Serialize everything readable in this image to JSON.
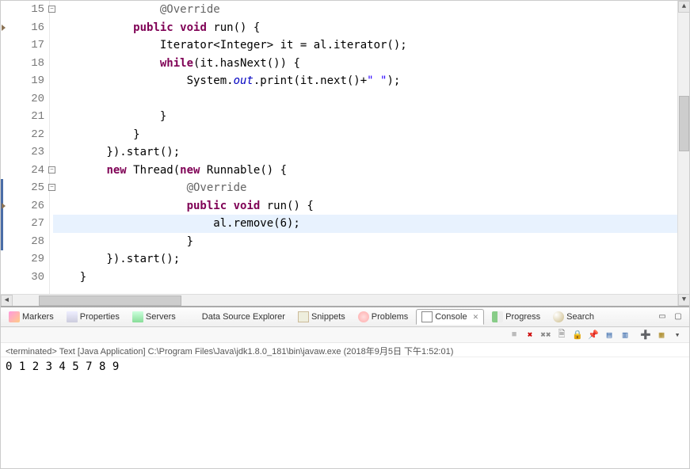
{
  "editor": {
    "highlighted_line_number": 27,
    "lines": [
      {
        "n": 15,
        "fold": true,
        "marker": "",
        "bp": false,
        "tokens": [
          {
            "t": "                ",
            "c": ""
          },
          {
            "t": "@Override",
            "c": "ann"
          }
        ]
      },
      {
        "n": 16,
        "fold": false,
        "marker": "triangle",
        "bp": false,
        "tokens": [
          {
            "t": "            ",
            "c": ""
          },
          {
            "t": "public",
            "c": "kw"
          },
          {
            "t": " ",
            "c": ""
          },
          {
            "t": "void",
            "c": "kw"
          },
          {
            "t": " run() {",
            "c": ""
          }
        ]
      },
      {
        "n": 17,
        "fold": false,
        "marker": "",
        "bp": false,
        "tokens": [
          {
            "t": "                Iterator<Integer> it = al.iterator();",
            "c": ""
          }
        ]
      },
      {
        "n": 18,
        "fold": false,
        "marker": "",
        "bp": false,
        "tokens": [
          {
            "t": "                ",
            "c": ""
          },
          {
            "t": "while",
            "c": "kw"
          },
          {
            "t": "(it.hasNext()) {",
            "c": ""
          }
        ]
      },
      {
        "n": 19,
        "fold": false,
        "marker": "",
        "bp": false,
        "tokens": [
          {
            "t": "                    System.",
            "c": ""
          },
          {
            "t": "out",
            "c": "static-field"
          },
          {
            "t": ".print(it.next()+",
            "c": ""
          },
          {
            "t": "\" \"",
            "c": "str"
          },
          {
            "t": ");",
            "c": ""
          }
        ]
      },
      {
        "n": 20,
        "fold": false,
        "marker": "",
        "bp": false,
        "tokens": [
          {
            "t": "                    ",
            "c": ""
          }
        ]
      },
      {
        "n": 21,
        "fold": false,
        "marker": "",
        "bp": false,
        "tokens": [
          {
            "t": "                }",
            "c": ""
          }
        ]
      },
      {
        "n": 22,
        "fold": false,
        "marker": "",
        "bp": false,
        "tokens": [
          {
            "t": "            }",
            "c": ""
          }
        ]
      },
      {
        "n": 23,
        "fold": false,
        "marker": "",
        "bp": false,
        "tokens": [
          {
            "t": "        }).start();",
            "c": ""
          }
        ]
      },
      {
        "n": 24,
        "fold": true,
        "marker": "",
        "bp": false,
        "tokens": [
          {
            "t": "        ",
            "c": ""
          },
          {
            "t": "new",
            "c": "kw"
          },
          {
            "t": " Thread(",
            "c": ""
          },
          {
            "t": "new",
            "c": "kw"
          },
          {
            "t": " Runnable() {",
            "c": ""
          }
        ]
      },
      {
        "n": 25,
        "fold": true,
        "marker": "",
        "bp": true,
        "tokens": [
          {
            "t": "                    ",
            "c": ""
          },
          {
            "t": "@Override",
            "c": "ann"
          }
        ]
      },
      {
        "n": 26,
        "fold": false,
        "marker": "triangle",
        "bp": true,
        "tokens": [
          {
            "t": "                    ",
            "c": ""
          },
          {
            "t": "public",
            "c": "kw"
          },
          {
            "t": " ",
            "c": ""
          },
          {
            "t": "void",
            "c": "kw"
          },
          {
            "t": " run() {",
            "c": ""
          }
        ]
      },
      {
        "n": 27,
        "fold": false,
        "marker": "",
        "bp": true,
        "tokens": [
          {
            "t": "                        al.remove(6);",
            "c": ""
          }
        ]
      },
      {
        "n": 28,
        "fold": false,
        "marker": "",
        "bp": true,
        "tokens": [
          {
            "t": "                    }",
            "c": ""
          }
        ]
      },
      {
        "n": 29,
        "fold": false,
        "marker": "",
        "bp": false,
        "tokens": [
          {
            "t": "        }).start();",
            "c": ""
          }
        ]
      },
      {
        "n": 30,
        "fold": false,
        "marker": "",
        "bp": false,
        "tokens": [
          {
            "t": "    }",
            "c": ""
          }
        ]
      }
    ]
  },
  "tabs": [
    {
      "id": "markers",
      "label": "Markers",
      "active": false
    },
    {
      "id": "properties",
      "label": "Properties",
      "active": false
    },
    {
      "id": "servers",
      "label": "Servers",
      "active": false
    },
    {
      "id": "data-source-explorer",
      "label": "Data Source Explorer",
      "active": false
    },
    {
      "id": "snippets",
      "label": "Snippets",
      "active": false
    },
    {
      "id": "problems",
      "label": "Problems",
      "active": false
    },
    {
      "id": "console",
      "label": "Console",
      "active": true
    },
    {
      "id": "progress",
      "label": "Progress",
      "active": false
    },
    {
      "id": "search",
      "label": "Search",
      "active": false
    }
  ],
  "tab_close_icon": "✕",
  "console": {
    "status_prefix": "<terminated>",
    "status_text": "Text [Java Application] C:\\Program Files\\Java\\jdk1.8.0_181\\bin\\javaw.exe (2018年9月5日 下午1:52:01)",
    "output": "0 1 2 3 4 5 7 8 9 "
  }
}
